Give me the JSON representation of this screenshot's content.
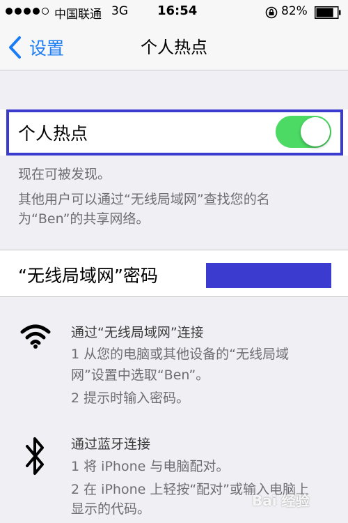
{
  "status_bar": {
    "carrier": "中国联通",
    "network": "3G",
    "time": "16:54",
    "battery": "82%",
    "battery_level": 0.82
  },
  "nav": {
    "back_label": "设置",
    "title": "个人热点"
  },
  "hotspot": {
    "label": "个人热点",
    "toggle_on": true,
    "toggle_color": "#4cd964"
  },
  "notes": {
    "discoverable": "现在可被发现。",
    "line1": "其他用户可以通过“无线局域网”查找您的名",
    "line2": "为“Ben”的共享网络。"
  },
  "password": {
    "label": "“无线局域网”密码"
  },
  "wifi_section": {
    "icon": "wifi-icon",
    "heading": "通过“无线局域网”连接",
    "steps": [
      "1 从您的电脑或其他设备的“无线局域",
      "网”设置中选取“Ben”。",
      "2 提示时输入密码。"
    ]
  },
  "bluetooth_section": {
    "icon": "bluetooth-icon",
    "heading": "通过蓝牙连接",
    "steps": [
      "1 将 iPhone 与电脑配对。",
      "2 在 iPhone 上轻按“配对”或输入电脑上",
      "显示的代码。"
    ]
  },
  "watermark": "Bai 经验",
  "colors": {
    "accent": "#1a7cf5",
    "highlight": "#3b3bcf",
    "background": "#efeff4"
  }
}
